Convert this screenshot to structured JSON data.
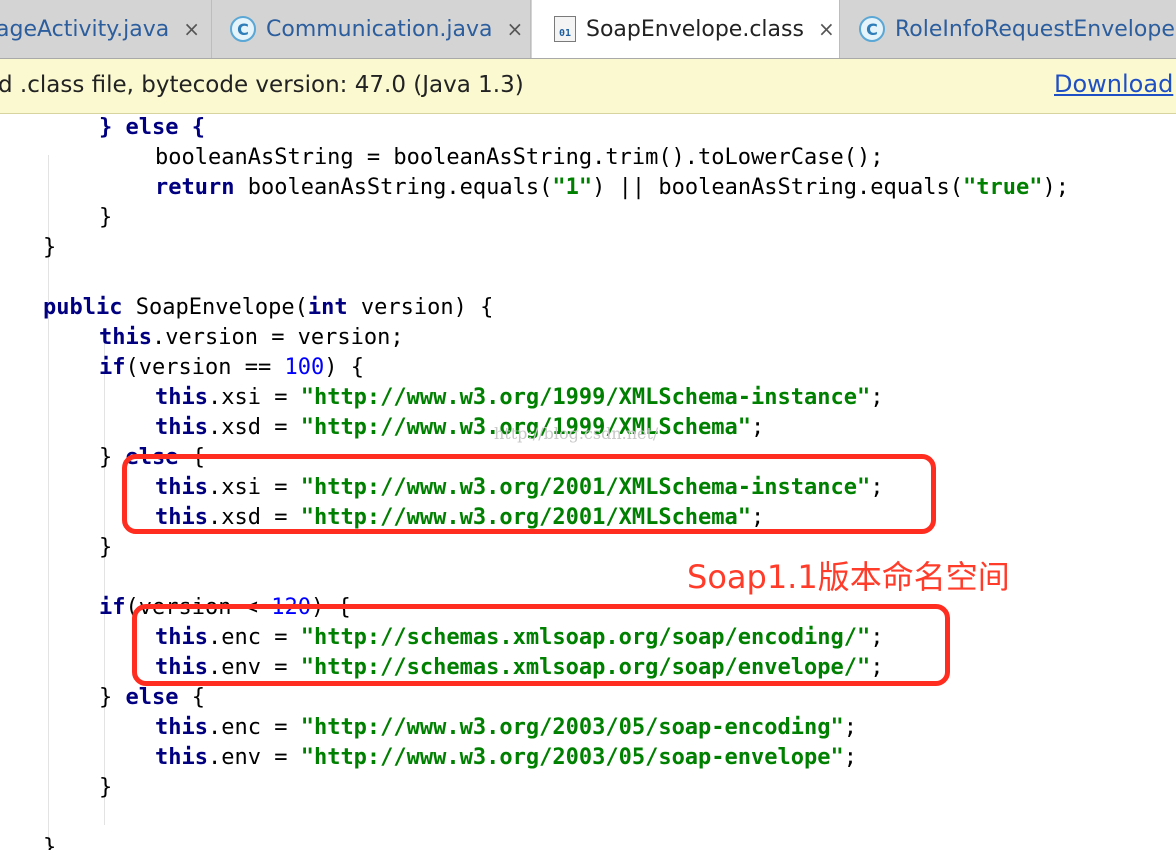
{
  "tabs": [
    {
      "label": "ageActivity.java",
      "icon": "none",
      "active": false
    },
    {
      "label": "Communication.java",
      "icon": "c",
      "active": false
    },
    {
      "label": "SoapEnvelope.class",
      "icon": "class-file",
      "active": true
    },
    {
      "label": "RoleInfoRequestEnvelope.ja",
      "icon": "c",
      "active": false
    }
  ],
  "tab_icon_letter": "C",
  "class_icon_text": "01",
  "close_glyph": "×",
  "notice": {
    "text": "d .class file, bytecode version: 47.0 (Java 1.3)",
    "link": "Download"
  },
  "code_lines": [
    [
      [
        "kw",
        "} else {"
      ]
    ],
    [
      [
        "",
        "booleanAsString = booleanAsString.trim().toLowerCase();"
      ]
    ],
    [
      [
        "kw",
        "return"
      ],
      [
        "",
        " booleanAsString.equals("
      ],
      [
        "str",
        "\"1\""
      ],
      [
        "",
        ") || booleanAsString.equals("
      ],
      [
        "str",
        "\"true\""
      ],
      [
        "",
        ");"
      ]
    ],
    [
      [
        "",
        "}"
      ]
    ],
    [
      [
        "",
        "}"
      ]
    ],
    [],
    [
      [
        "kw",
        "public"
      ],
      [
        "",
        " SoapEnvelope("
      ],
      [
        "kw",
        "int"
      ],
      [
        "",
        " version) {"
      ]
    ],
    [
      [
        "kw",
        "this"
      ],
      [
        "",
        ".version = version;"
      ]
    ],
    [
      [
        "kw",
        "if"
      ],
      [
        "",
        "(version == "
      ],
      [
        "num",
        "100"
      ],
      [
        "",
        ") {"
      ]
    ],
    [
      [
        "kw",
        "this"
      ],
      [
        "",
        ".xsi = "
      ],
      [
        "str",
        "\"http://www.w3.org/1999/XMLSchema-instance\""
      ],
      [
        "",
        ";"
      ]
    ],
    [
      [
        "kw",
        "this"
      ],
      [
        "",
        ".xsd = "
      ],
      [
        "str",
        "\"http://www.w3.org/1999/XMLSchema\""
      ],
      [
        "",
        ";"
      ]
    ],
    [
      [
        "",
        "} "
      ],
      [
        "kw",
        "else"
      ],
      [
        "",
        " {"
      ]
    ],
    [
      [
        "kw",
        "this"
      ],
      [
        "",
        ".xsi = "
      ],
      [
        "str",
        "\"http://www.w3.org/2001/XMLSchema-instance\""
      ],
      [
        "",
        ";"
      ]
    ],
    [
      [
        "kw",
        "this"
      ],
      [
        "",
        ".xsd = "
      ],
      [
        "str",
        "\"http://www.w3.org/2001/XMLSchema\""
      ],
      [
        "",
        ";"
      ]
    ],
    [
      [
        "",
        "}"
      ]
    ],
    [],
    [
      [
        "kw",
        "if"
      ],
      [
        "",
        "(version < "
      ],
      [
        "num",
        "120"
      ],
      [
        "",
        ") {"
      ]
    ],
    [
      [
        "kw",
        "this"
      ],
      [
        "",
        ".enc = "
      ],
      [
        "str",
        "\"http://schemas.xmlsoap.org/soap/encoding/\""
      ],
      [
        "",
        ";"
      ]
    ],
    [
      [
        "kw",
        "this"
      ],
      [
        "",
        ".env = "
      ],
      [
        "str",
        "\"http://schemas.xmlsoap.org/soap/envelope/\""
      ],
      [
        "",
        ";"
      ]
    ],
    [
      [
        "",
        "} "
      ],
      [
        "kw",
        "else"
      ],
      [
        "",
        " {"
      ]
    ],
    [
      [
        "kw",
        "this"
      ],
      [
        "",
        ".enc = "
      ],
      [
        "str",
        "\"http://www.w3.org/2003/05/soap-encoding\""
      ],
      [
        "",
        ";"
      ]
    ],
    [
      [
        "kw",
        "this"
      ],
      [
        "",
        ".env = "
      ],
      [
        "str",
        "\"http://www.w3.org/2003/05/soap-envelope\""
      ],
      [
        "",
        ";"
      ]
    ],
    [
      [
        "",
        "}"
      ]
    ],
    [],
    [
      [
        "",
        "}"
      ]
    ]
  ],
  "annotation": "Soap1.1版本命名空间",
  "watermark": "http://blog.csdn.net/"
}
